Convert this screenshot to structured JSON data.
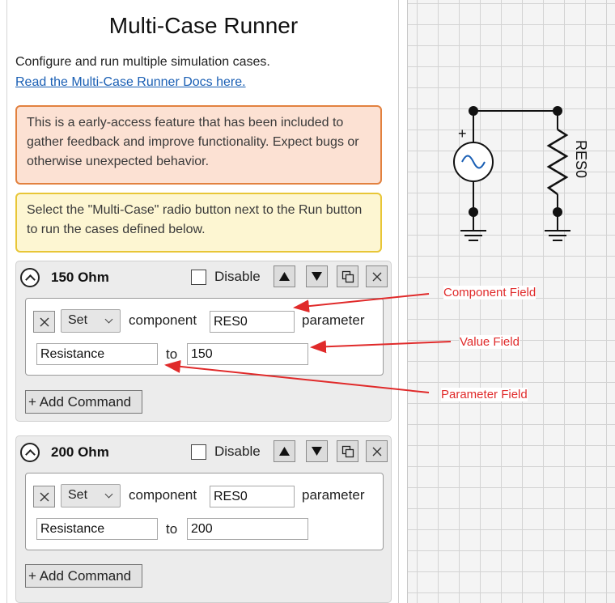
{
  "panel": {
    "title": "Multi-Case Runner",
    "intro": "Configure and run multiple simulation cases.",
    "docs_link": "Read the Multi-Case Runner Docs here.",
    "warning_banner": "This is a early-access feature that has been included to gather feedback and improve functionality. Expect bugs or otherwise unexpected behavior.",
    "info_banner": "Select the \"Multi-Case\" radio button next to the Run button to run the cases defined below."
  },
  "cases": [
    {
      "name": "150 Ohm",
      "disable_label": "Disable",
      "disabled": false,
      "command": {
        "verb": "Set",
        "component_label": "component",
        "component": "RES0",
        "parameter_label": "parameter",
        "parameter": "Resistance",
        "to_label": "to",
        "value": "150"
      },
      "add_command_label": "+ Add Command"
    },
    {
      "name": "200 Ohm",
      "disable_label": "Disable",
      "disabled": false,
      "command": {
        "verb": "Set",
        "component_label": "component",
        "component": "RES0",
        "parameter_label": "parameter",
        "parameter": "Resistance",
        "to_label": "to",
        "value": "200"
      },
      "add_command_label": "+ Add Command"
    }
  ],
  "schematic": {
    "resistor_label": "RES0",
    "source_polarity": "+"
  },
  "annotations": {
    "component_field": "Component Field",
    "value_field": "Value Field",
    "parameter_field": "Parameter Field"
  },
  "colors": {
    "annotation": "#e02a2a",
    "link": "#1a5fb4",
    "warning_border": "#e2813f",
    "info_border": "#e8c637",
    "source_blue": "#1a5fb4"
  }
}
